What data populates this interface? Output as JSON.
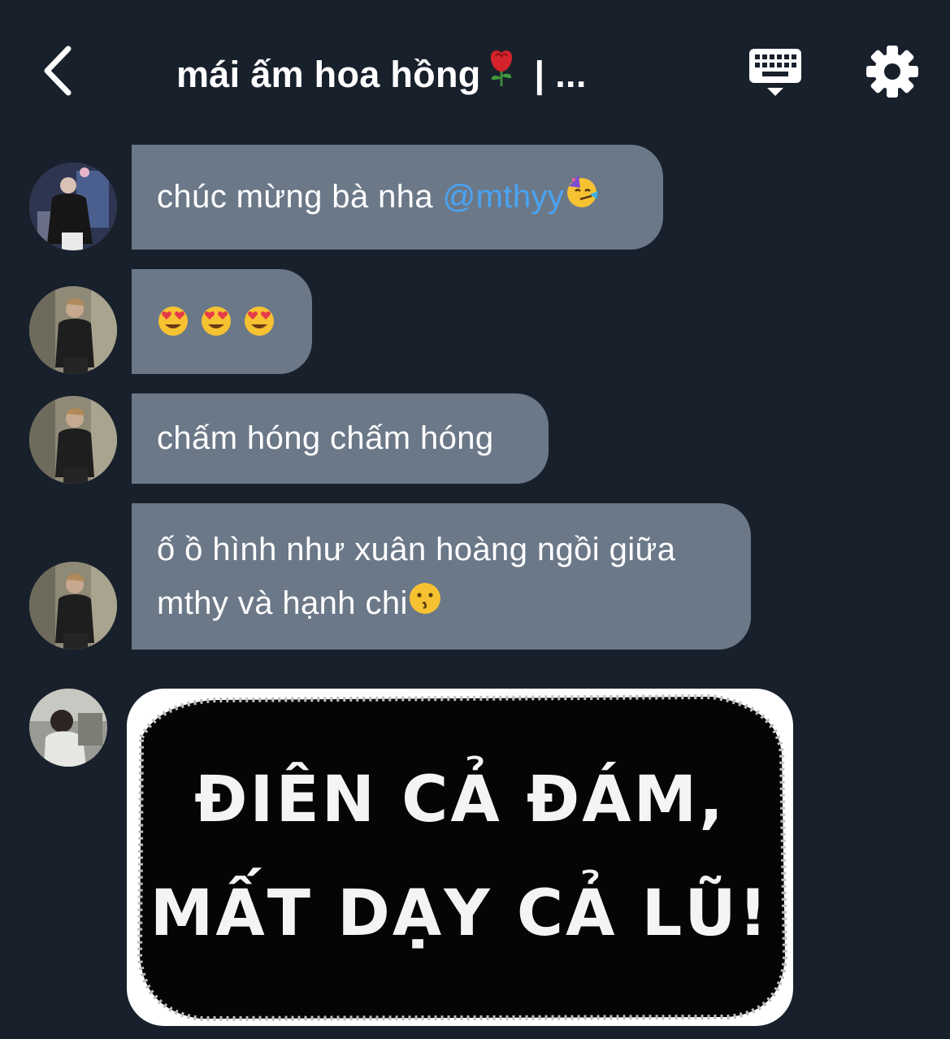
{
  "header": {
    "title": "mái ấm hoa hồng",
    "title_suffix": "| ...",
    "back_icon": "chevron-left-icon",
    "keyboard_icon": "keyboard-icon",
    "settings_icon": "gear-icon"
  },
  "messages": [
    {
      "text": "chúc mừng bà nha ",
      "mention": "@mthyy",
      "emoji": "partying-face-emoji"
    },
    {
      "emojis": [
        "heart-eyes-emoji",
        "heart-eyes-emoji",
        "heart-eyes-emoji"
      ]
    },
    {
      "text": "chấm hóng chấm hóng"
    },
    {
      "lines": [
        "ố ồ hình như xuân hoàng ngồi giữa",
        "mthy và hạnh chi"
      ],
      "emoji": "kissing-face-emoji"
    },
    {
      "image_text": [
        "ĐIÊN CẢ ĐÁM,",
        "MẤT DẠY CẢ LŨ!"
      ]
    }
  ],
  "colors": {
    "background": "#18202c",
    "bubble": "#6b7888",
    "mention": "#4aa3f2",
    "text": "#ffffff"
  }
}
